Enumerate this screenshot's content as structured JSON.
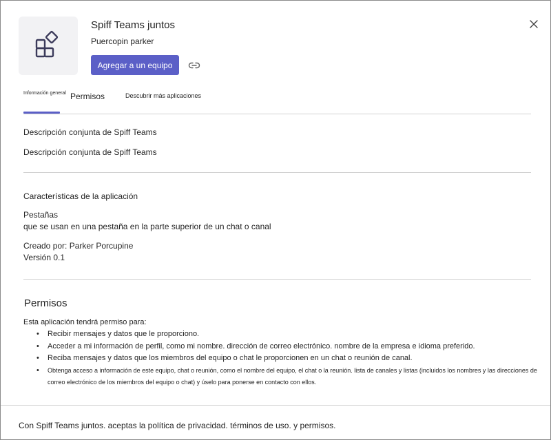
{
  "header": {
    "app_name": "Spiff Teams juntos",
    "publisher": "Puercopin parker",
    "add_button_label": "Agregar a un equipo",
    "icon_name": "app-grid-icon",
    "link_icon_name": "link-icon",
    "close_icon_name": "close-icon"
  },
  "tabs": [
    {
      "label": "Información general",
      "active": true
    },
    {
      "label": "Permisos",
      "active": false
    },
    {
      "label": "Descubrir más aplicaciones",
      "active": false
    }
  ],
  "description": {
    "short": "Descripción conjunta de Spiff Teams",
    "long": "Descripción conjunta de Spiff Teams"
  },
  "features": {
    "heading": "Características de la aplicación",
    "tabs_title": "Pestañas",
    "tabs_desc": "que se usan en una pestaña en la parte superior de un chat o canal",
    "created_by": "Creado por: Parker Porcupine",
    "version": "Versión 0.1"
  },
  "permissions": {
    "heading": "Permisos",
    "intro": "Esta aplicación tendrá permiso para:",
    "items": [
      "Recibir mensajes y datos que le proporciono.",
      "Acceder a mi información de perfil, como mi nombre. dirección de correo electrónico. nombre de la empresa e idioma preferido.",
      "Reciba mensajes y datos que los miembros del equipo o chat le proporcionen en un chat o reunión de canal.",
      "Obtenga acceso a información de este equipo, chat o reunión, como el nombre del equipo, el chat o la reunión. lista de canales y listas (incluidos los nombres y las direcciones de correo electrónico de los miembros del equipo o chat) y úselo para ponerse en contacto con ellos."
    ]
  },
  "footer": {
    "text": "Con Spiff Teams juntos. aceptas la política de privacidad. términos de uso. y permisos."
  },
  "colors": {
    "accent": "#5b5fc7",
    "divider": "#d1d1d1",
    "tile_bg": "#f2f2f4"
  }
}
